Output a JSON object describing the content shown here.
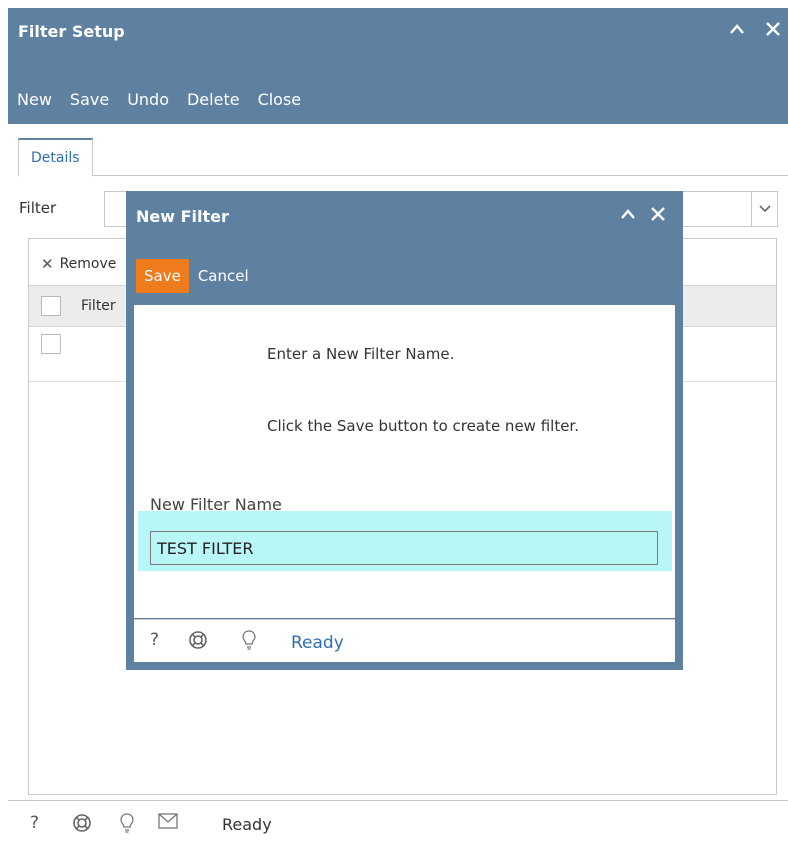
{
  "window": {
    "title": "Filter Setup",
    "toolbar": [
      "New",
      "Save",
      "Undo",
      "Delete",
      "Close"
    ],
    "tab": "Details",
    "filter_label": "Filter",
    "filter_value": "",
    "grid": {
      "remove_label": "Remove",
      "columns": [
        "Filter"
      ]
    },
    "status": "Ready",
    "icons": [
      "help-icon",
      "support-icon",
      "tips-icon",
      "email-icon"
    ]
  },
  "modal": {
    "title": "New Filter",
    "save_label": "Save",
    "cancel_label": "Cancel",
    "message1": "Enter a New Filter Name.",
    "message2": "Click the Save button to create new filter.",
    "field_label": "New Filter Name",
    "field_value": "TEST FILTER",
    "status": "Ready"
  },
  "colors": {
    "header": "#5e81a2",
    "accent_save": "#ee7b1c",
    "field_highlight": "#b8f6f8",
    "link_blue": "#2f6fb0"
  }
}
